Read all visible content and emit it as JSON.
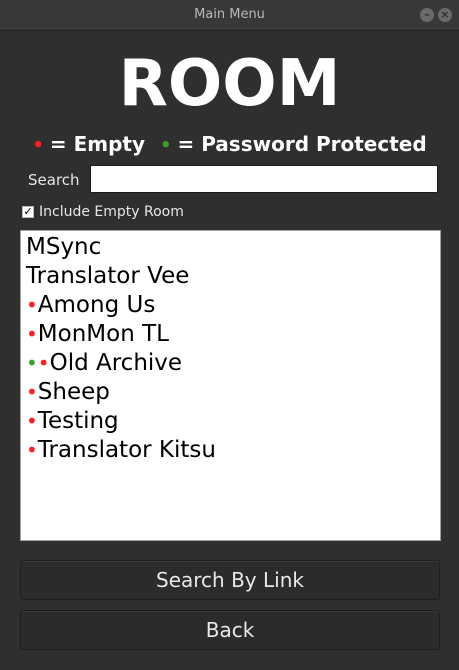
{
  "window": {
    "title": "Main Menu"
  },
  "heading": "ROOM",
  "legend": {
    "empty_label": "= Empty",
    "protected_label": "= Password Protected",
    "empty_color": "#ff2020",
    "protected_color": "#3aa02a"
  },
  "search": {
    "label": "Search",
    "value": ""
  },
  "include_empty": {
    "label": "Include Empty Room",
    "checked": true
  },
  "rooms": [
    {
      "name": "MSync",
      "empty": false,
      "protected": false
    },
    {
      "name": "Translator Vee",
      "empty": false,
      "protected": false
    },
    {
      "name": "Among Us",
      "empty": true,
      "protected": false
    },
    {
      "name": "MonMon TL",
      "empty": true,
      "protected": false
    },
    {
      "name": "Old Archive",
      "empty": true,
      "protected": true
    },
    {
      "name": "Sheep",
      "empty": true,
      "protected": false
    },
    {
      "name": "Testing",
      "empty": true,
      "protected": false
    },
    {
      "name": "Translator Kitsu",
      "empty": true,
      "protected": false
    }
  ],
  "buttons": {
    "search_by_link": "Search By Link",
    "back": "Back"
  }
}
